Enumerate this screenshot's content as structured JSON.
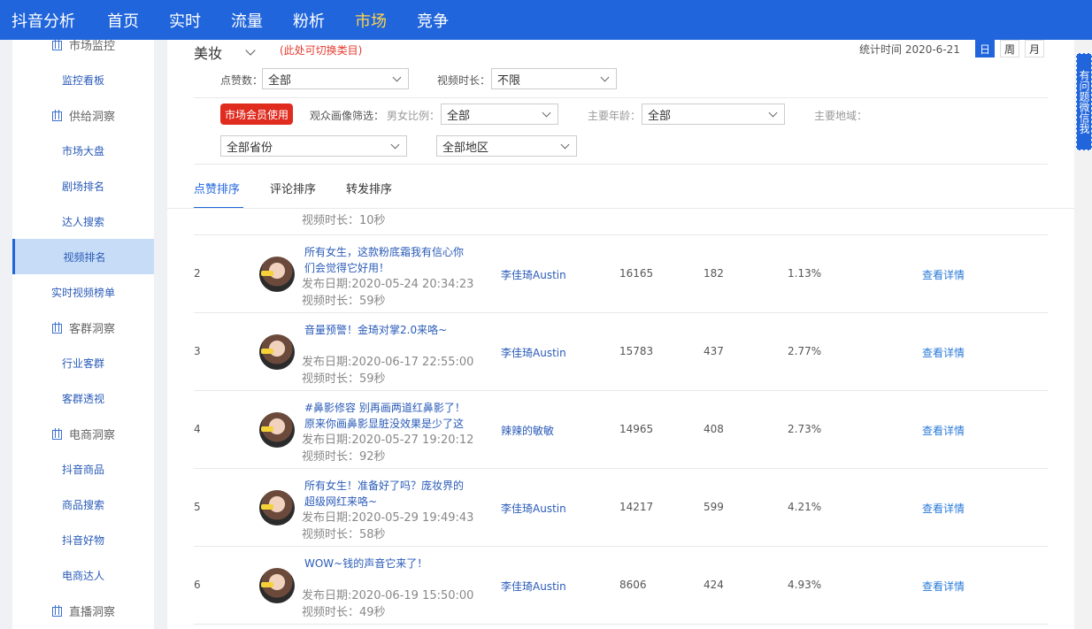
{
  "nav": {
    "brand": "抖音分析",
    "items": [
      "首页",
      "实时",
      "流量",
      "粉析",
      "市场",
      "竞争"
    ],
    "active": "市场"
  },
  "sidebar": {
    "items": [
      {
        "label": "市场监控",
        "group": true
      },
      {
        "label": "监控看板",
        "group": false
      },
      {
        "label": "供给洞察",
        "group": true
      },
      {
        "label": "市场大盘",
        "group": false
      },
      {
        "label": "剧场排名",
        "group": false
      },
      {
        "label": "达人搜索",
        "group": false
      },
      {
        "label": "视频排名",
        "group": false,
        "active": true
      },
      {
        "label": "实时视频榜单",
        "group": false
      },
      {
        "label": "客群洞察",
        "group": true
      },
      {
        "label": "行业客群",
        "group": false
      },
      {
        "label": "客群透视",
        "group": false
      },
      {
        "label": "电商洞察",
        "group": true
      },
      {
        "label": "抖音商品",
        "group": false
      },
      {
        "label": "商品搜索",
        "group": false
      },
      {
        "label": "抖音好物",
        "group": false
      },
      {
        "label": "电商达人",
        "group": false
      },
      {
        "label": "直播洞察",
        "group": true
      }
    ]
  },
  "filters": {
    "category": "美妆",
    "category_hint": "(此处可切换类目)",
    "stat_time": "统计时间 2020-6-21",
    "periods": [
      "日",
      "周",
      "月"
    ],
    "likes_label": "点赞数：",
    "likes_value": "全部",
    "duration_label": "视频时长：",
    "duration_value": "不限",
    "member_button": "市场会员使用",
    "audience_label": "观众画像筛选：",
    "gender_label": "男女比例：",
    "gender_value": "全部",
    "age_label": "主要年龄：",
    "age_value": "全部",
    "region_label": "主要地域：",
    "province_value": "全部省份",
    "area_value": "全部地区"
  },
  "tabs": [
    "点赞排序",
    "评论排序",
    "转发排序"
  ],
  "partial_duration": "视频时长：10秒",
  "rows": [
    {
      "rank": "2",
      "title": "所有女生，这款粉底霜我有信心你们会觉得它好用！",
      "date": "发布日期:2020-05-24 20:34:23",
      "duration": "视频时长：59秒",
      "author": "李佳琦Austin",
      "likes": "16165",
      "comments": "182",
      "rate": "1.13%",
      "detail": "查看详情"
    },
    {
      "rank": "3",
      "title": "音量预警！金琦对掌2.0来咯~",
      "date": "发布日期:2020-06-17 22:55:00",
      "duration": "视频时长：59秒",
      "author": "李佳琦Austin",
      "likes": "15783",
      "comments": "437",
      "rate": "2.77%",
      "detail": "查看详情"
    },
    {
      "rank": "4",
      "title": "#鼻影修容 别再画两道红鼻影了！原来你画鼻影显脏没效果是少了这",
      "date": "发布日期:2020-05-27 19:20:12",
      "duration": "视频时长：92秒",
      "author": "辣辣的敏敏",
      "likes": "14965",
      "comments": "408",
      "rate": "2.73%",
      "detail": "查看详情"
    },
    {
      "rank": "5",
      "title": "所有女生！准备好了吗？庞妆界的超级网红来咯~",
      "date": "发布日期:2020-05-29 19:49:43",
      "duration": "视频时长：58秒",
      "author": "李佳琦Austin",
      "likes": "14217",
      "comments": "599",
      "rate": "4.21%",
      "detail": "查看详情"
    },
    {
      "rank": "6",
      "title": "WOW~钱的声音它来了！",
      "date": "发布日期:2020-06-19 15:50:00",
      "duration": "视频时长：49秒",
      "author": "李佳琦Austin",
      "likes": "8606",
      "comments": "424",
      "rate": "4.93%",
      "detail": "查看详情"
    }
  ],
  "help": "有问题微信我"
}
